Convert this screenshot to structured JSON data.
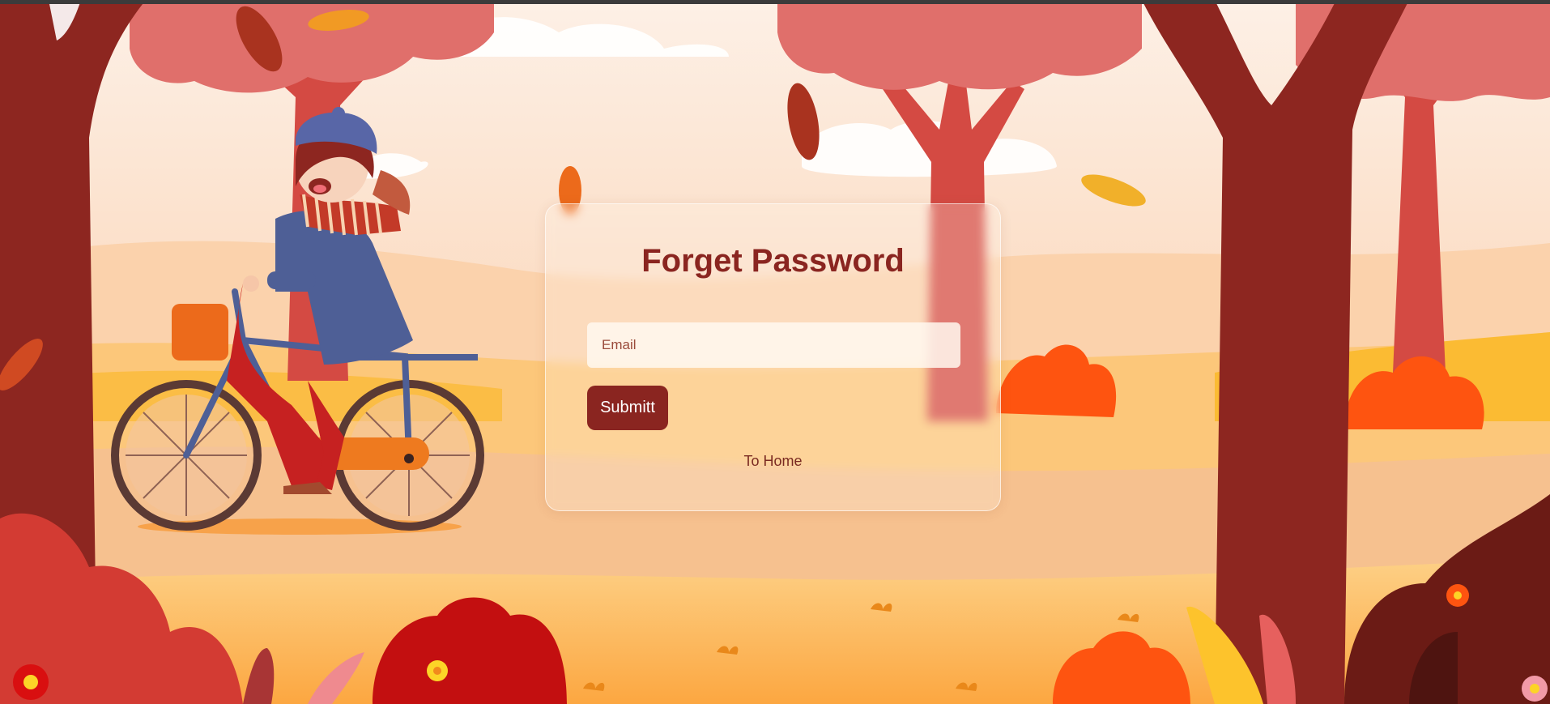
{
  "page": {
    "title": "Forget Password"
  },
  "form": {
    "email_placeholder": "Email",
    "email_value": "",
    "submit_label": "Submitt",
    "home_link_label": "To Home"
  },
  "scene": {
    "theme": "autumn-park-illustration",
    "icons": [
      "tree-icon",
      "leaf-icon",
      "bush-icon",
      "flower-icon",
      "bicycle-icon",
      "girl-character-icon",
      "cloud-icon"
    ]
  },
  "colors": {
    "accent": "#8a2520",
    "sky": "#fbe7d6",
    "ground": "#fdb54a",
    "tree_dark": "#8d2620",
    "tree_light": "#e16c68"
  }
}
